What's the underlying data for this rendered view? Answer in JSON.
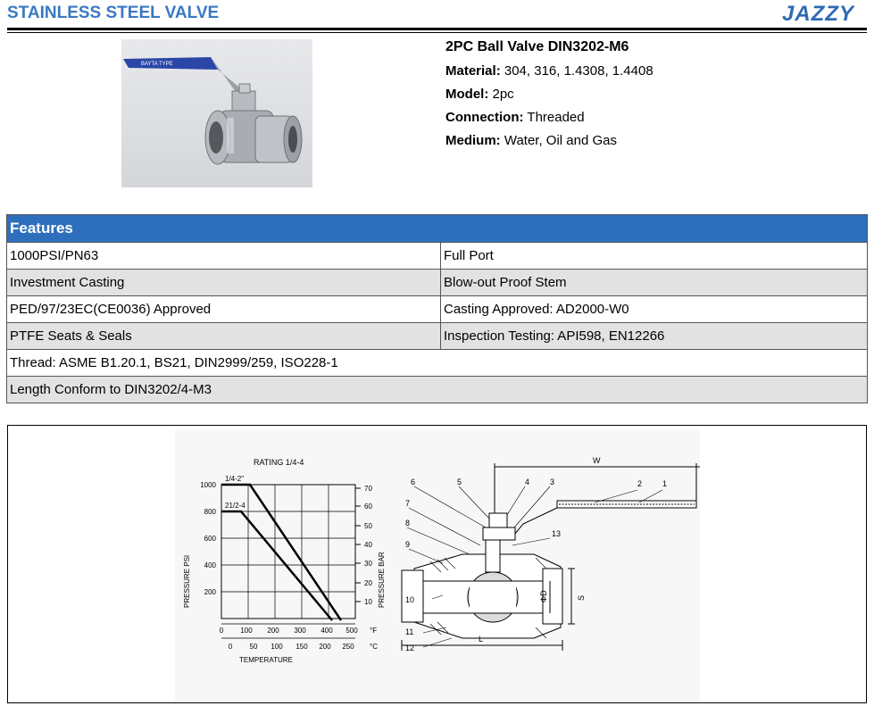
{
  "header": {
    "title": "STAINLESS STEEL VALVE",
    "brand": "JAZZY"
  },
  "product": {
    "title": "2PC Ball Valve DIN3202-M6",
    "specs": [
      {
        "label": "Material:",
        "value": "304, 316, 1.4308, 1.4408"
      },
      {
        "label": "Model:",
        "value": "2pc"
      },
      {
        "label": "Connection:",
        "value": "Threaded"
      },
      {
        "label": "Medium:",
        "value": "Water, Oil and Gas"
      }
    ],
    "photo_label": "BAYTA TYPE"
  },
  "features": {
    "header": "Features",
    "rows": [
      [
        "1000PSI/PN63",
        "Full Port"
      ],
      [
        "Investment Casting",
        "Blow-out Proof Stem"
      ],
      [
        "PED/97/23EC(CE0036) Approved",
        "Casting Approved: AD2000-W0"
      ],
      [
        "PTFE Seats & Seals",
        "Inspection Testing: API598, EN12266"
      ],
      [
        "Thread: ASME B1.20.1, BS21, DIN2999/259, ISO228-1"
      ],
      [
        "Length Conform to DIN3202/4-M3"
      ]
    ]
  },
  "rating_chart": {
    "title": "RATING 1/4-4",
    "psi_ticks": [
      "1000",
      "800",
      "600",
      "400",
      "200"
    ],
    "bar_ticks": [
      "70",
      "60",
      "50",
      "40",
      "30",
      "20",
      "10"
    ],
    "f_ticks": [
      "0",
      "100",
      "200",
      "300",
      "400",
      "500"
    ],
    "c_ticks": [
      "0",
      "50",
      "100",
      "150",
      "200",
      "250"
    ],
    "unit_f": "°F",
    "unit_c": "°C",
    "ylabel_left": "PRESSURE PSI",
    "ylabel_right": "PRESSURE BAR",
    "xlabel": "TEMPERATURE",
    "series": [
      {
        "name": "1/4-2\""
      },
      {
        "name": "21/2-4"
      }
    ]
  },
  "section_drawing": {
    "callouts": [
      "1",
      "2",
      "3",
      "4",
      "5",
      "6",
      "7",
      "8",
      "9",
      "10",
      "11",
      "12",
      "13"
    ],
    "dim_w": "W",
    "dim_l": "L",
    "dim_d": "ΦD",
    "dim_s": "S"
  }
}
